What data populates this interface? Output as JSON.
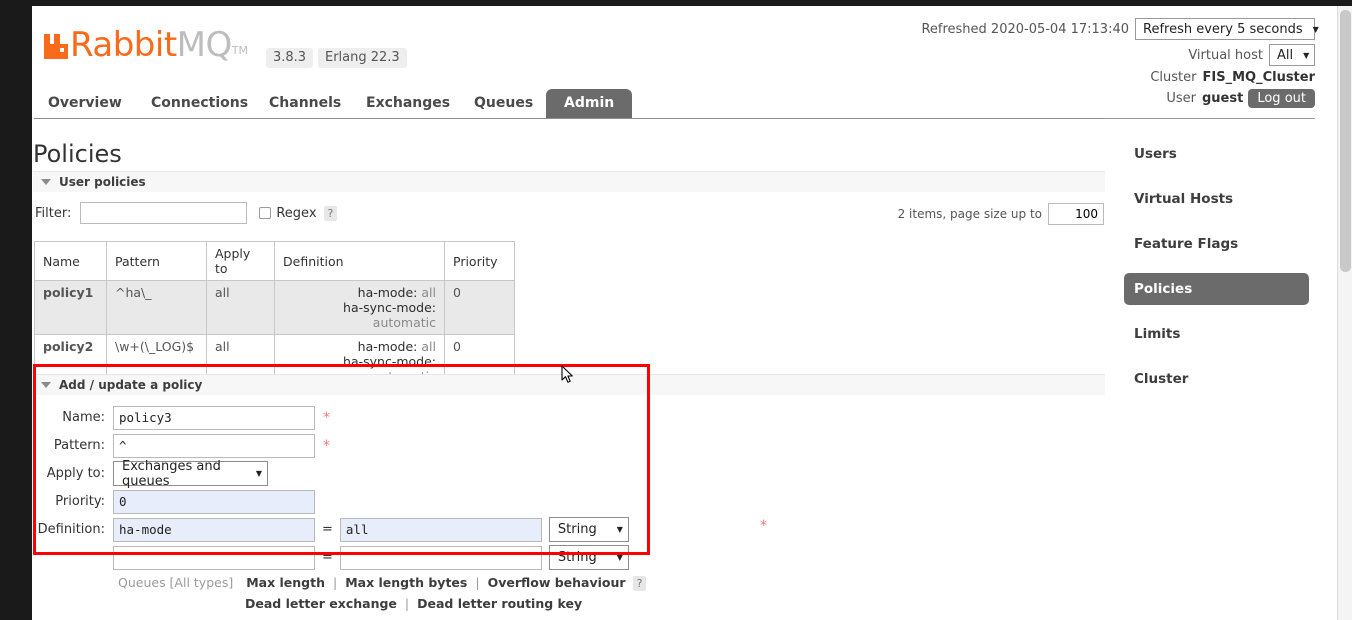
{
  "header": {
    "product_name_primary": "Rabbit",
    "product_name_secondary": "MQ",
    "trademark": "TM",
    "version_badge": "3.8.3",
    "erlang_badge": "Erlang 22.3",
    "refreshed_label": "Refreshed 2020-05-04 17:13:40",
    "refresh_select_value": "Refresh every 5 seconds",
    "vhost_label": "Virtual host",
    "vhost_select_value": "All",
    "cluster_label": "Cluster",
    "cluster_name": "FIS_MQ_Cluster",
    "user_label": "User",
    "user_name": "guest",
    "logout_label": "Log out",
    "caret": "▼"
  },
  "nav": {
    "tabs": [
      {
        "label": "Overview",
        "active": false
      },
      {
        "label": "Connections",
        "active": false
      },
      {
        "label": "Channels",
        "active": false
      },
      {
        "label": "Exchanges",
        "active": false
      },
      {
        "label": "Queues",
        "active": false
      },
      {
        "label": "Admin",
        "active": true
      }
    ]
  },
  "page": {
    "title": "Policies"
  },
  "user_policies_section": {
    "title": "User policies",
    "filter_label": "Filter:",
    "filter_value": "",
    "filter_placeholder": "",
    "regex_label": "Regex",
    "regex_checked": false,
    "help_mark": "?",
    "items_count_label": "2 items, page size up to",
    "page_size_value": "100",
    "table": {
      "columns": [
        "Name",
        "Pattern",
        "Apply to",
        "Definition",
        "Priority"
      ],
      "rows": [
        {
          "name": "policy1",
          "pattern": "^ha\\_",
          "apply_to": "all",
          "definition": [
            {
              "key": "ha-mode:",
              "value": "all"
            },
            {
              "key": "ha-sync-mode:",
              "value": "automatic"
            }
          ],
          "priority": "0"
        },
        {
          "name": "policy2",
          "pattern": "\\w+(\\_LOG)$",
          "apply_to": "all",
          "definition": [
            {
              "key": "ha-mode:",
              "value": "all"
            },
            {
              "key": "ha-sync-mode:",
              "value": "automatic"
            }
          ],
          "priority": "0"
        }
      ]
    }
  },
  "add_policy_section": {
    "title": "Add / update a policy",
    "required_marker": "*",
    "fields": {
      "name_label": "Name:",
      "name_value": "policy3",
      "pattern_label": "Pattern:",
      "pattern_value": "^",
      "apply_to_label": "Apply to:",
      "apply_to_value": "Exchanges and queues",
      "priority_label": "Priority:",
      "priority_value": "0",
      "definition_label": "Definition:",
      "definition_rows": [
        {
          "key": "ha-mode",
          "equals": "=",
          "value": "all",
          "type": "String"
        },
        {
          "key": "",
          "equals": "=",
          "value": "",
          "type": "String"
        }
      ]
    },
    "shortcut_links": {
      "queues_note": "Queues [All types]",
      "row1": [
        "Max length",
        "Max length bytes",
        "Overflow behaviour"
      ],
      "row2": [
        "Dead letter exchange",
        "Dead letter routing key"
      ],
      "separator": "|",
      "help_mark": "?"
    }
  },
  "sidebar": {
    "items": [
      {
        "label": "Users",
        "active": false
      },
      {
        "label": "Virtual Hosts",
        "active": false
      },
      {
        "label": "Feature Flags",
        "active": false
      },
      {
        "label": "Policies",
        "active": true
      },
      {
        "label": "Limits",
        "active": false
      },
      {
        "label": "Cluster",
        "active": false
      }
    ]
  },
  "colors": {
    "brand_orange": "#f96a1b",
    "highlight_red": "#ff0000",
    "active_gray": "#6b6b6b",
    "filled_input_blue": "#e8edfb"
  }
}
